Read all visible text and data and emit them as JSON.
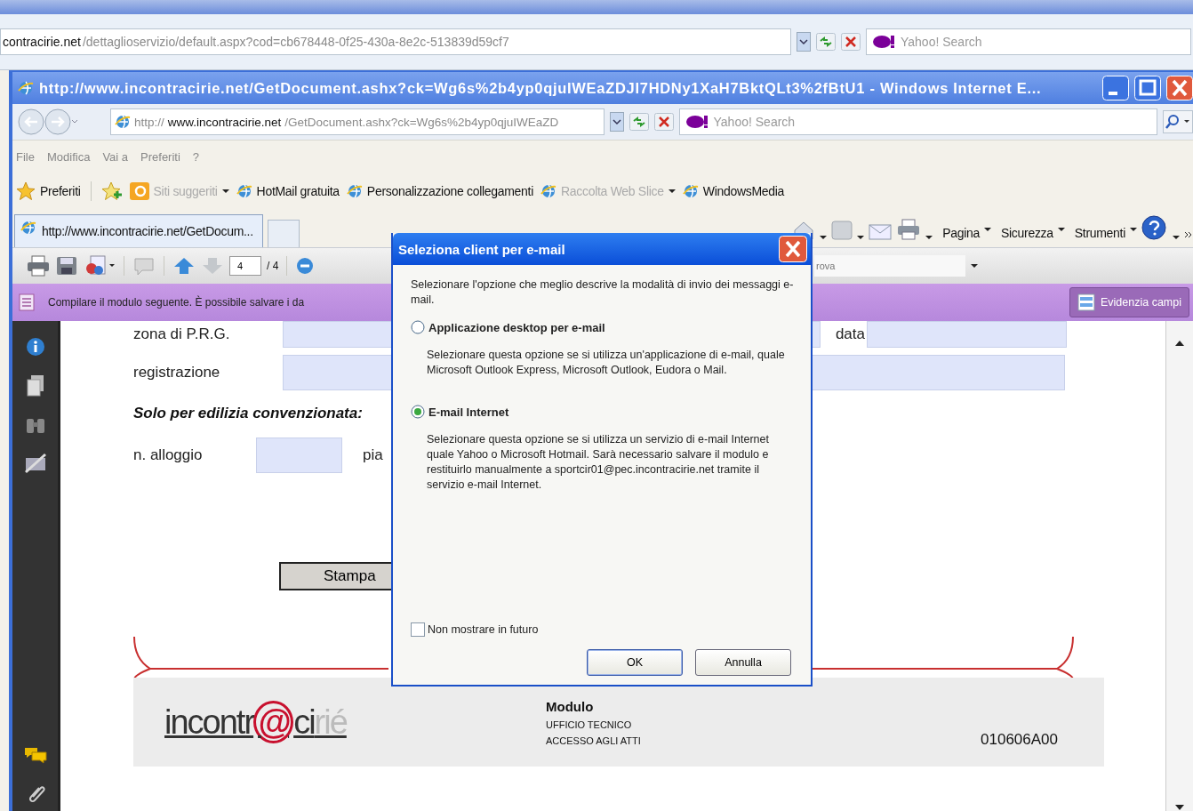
{
  "outer_window": {
    "address": {
      "host": "contracirie.net",
      "path": "/dettaglioservizio/default.aspx?cod=cb678448-0f25-430a-8e2c-513839d59cf7"
    },
    "search": {
      "placeholder": "Yahoo! Search"
    }
  },
  "window": {
    "title": "http://www.incontracirie.net/GetDocument.ashx?ck=Wg6s%2b4yp0qjuIWEaZDJI7HDNy1XaH7BktQLt3%2fBtU1 - Windows Internet E...",
    "address": {
      "scheme": "http://",
      "host": "www.incontracirie.net",
      "path": "/GetDocument.ashx?ck=Wg6s%2b4yp0qjuIWEaZD"
    },
    "search": {
      "placeholder": "Yahoo! Search"
    }
  },
  "menu": [
    "File",
    "Modifica",
    "Vai a",
    "Preferiti",
    "?"
  ],
  "favorites": {
    "label": "Preferiti",
    "links": [
      {
        "label": "Siti suggeriti",
        "kind": "suggested",
        "disabled": true,
        "dropdown": true
      },
      {
        "label": "HotMail gratuita",
        "kind": "page",
        "disabled": false,
        "dropdown": false
      },
      {
        "label": "Personalizzazione collegamenti",
        "kind": "page",
        "disabled": false,
        "dropdown": false
      },
      {
        "label": "Raccolta Web Slice",
        "kind": "page",
        "disabled": true,
        "dropdown": true
      },
      {
        "label": "WindowsMedia",
        "kind": "page",
        "disabled": false,
        "dropdown": false
      }
    ]
  },
  "tabs": [
    {
      "label": "http://www.incontracirie.net/GetDocum...",
      "selected": true
    }
  ],
  "command_bar": [
    "Pagina",
    "Sicurezza",
    "Strumenti"
  ],
  "pdf_toolbar": {
    "page": "4",
    "total": "/ 4",
    "find": {
      "placeholder": "rova"
    }
  },
  "form_bar": {
    "message": "Compilare il modulo seguente. È possibile salvare i da",
    "button": "Evidenzia campi"
  },
  "document": {
    "zone_label": "zona di P.R.G.",
    "date_label": "data",
    "registration_label": "registrazione",
    "section_title": "Solo per edilizia convenzionata:",
    "flat_label": "n. alloggio",
    "floor_label": "pia",
    "print_button": "Stampa",
    "footer": {
      "logo": {
        "start": "incontr",
        "mark": "@",
        "middle": "ci",
        "end": "rié"
      },
      "title": "Modulo",
      "lines": [
        "UFFICIO TECNICO",
        "ACCESSO AGLI ATTI"
      ],
      "code": "010606A00"
    }
  },
  "dialog": {
    "title": "Seleziona client per e-mail",
    "intro": "Selezionare l'opzione che meglio descrive la modalità di invio dei messaggi e-mail.",
    "options": [
      {
        "label": "Applicazione desktop per e-mail",
        "description": "Selezionare questa opzione se si utilizza un'applicazione di e-mail, quale Microsoft Outlook Express, Microsoft Outlook, Eudora o Mail.",
        "selected": false
      },
      {
        "label": "E-mail Internet",
        "description": "Selezionare questa opzione se si utilizza un servizio di e-mail Internet quale Yahoo o Microsoft Hotmail. Sarà necessario salvare il modulo e restituirlo manualmente a sportcir01@pec.incontracirie.net tramite il servizio e-mail Internet.",
        "selected": true
      }
    ],
    "checkbox": {
      "label": "Non mostrare in futuro",
      "checked": false
    },
    "buttons": [
      {
        "label": "OK",
        "default": true
      },
      {
        "label": "Annulla",
        "default": false
      }
    ]
  }
}
